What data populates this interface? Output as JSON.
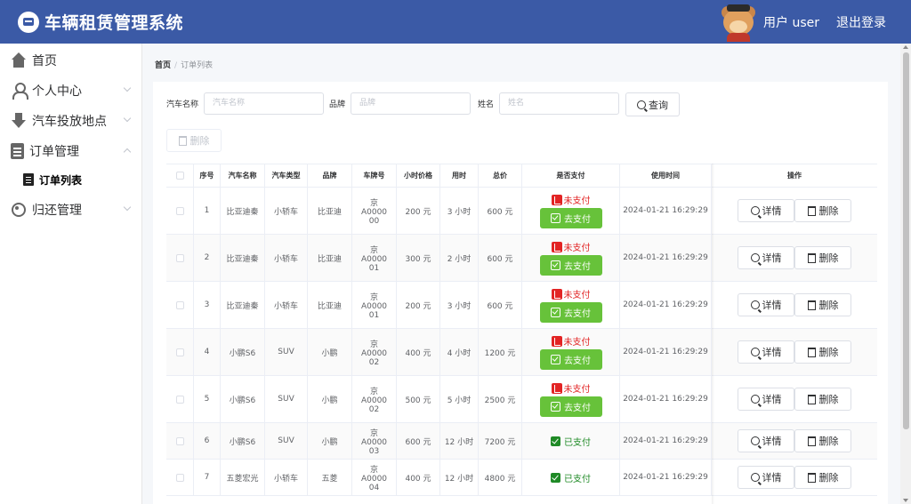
{
  "header": {
    "title": "车辆租赁管理系统",
    "user_label": "用户 user",
    "logout": "退出登录"
  },
  "sidebar": {
    "items": [
      {
        "label": "首页",
        "icon": "home-icon"
      },
      {
        "label": "个人中心",
        "icon": "user-icon"
      },
      {
        "label": "汽车投放地点",
        "icon": "download-icon"
      },
      {
        "label": "订单管理",
        "icon": "document-icon"
      },
      {
        "label": "归还管理",
        "icon": "return-icon"
      }
    ],
    "subitems": [
      {
        "label": "订单列表",
        "icon": "list-icon"
      }
    ]
  },
  "breadcrumb": {
    "home": "首页",
    "current": "订单列表"
  },
  "search": {
    "car_name_label": "汽车名称",
    "car_name_placeholder": "汽车名称",
    "brand_label": "品牌",
    "brand_placeholder": "品牌",
    "name_label": "姓名",
    "name_placeholder": "姓名",
    "query_button": "查询",
    "delete_button": "删除"
  },
  "table": {
    "headers": [
      "序号",
      "汽车名称",
      "汽车类型",
      "品牌",
      "车牌号",
      "小时价格",
      "用时",
      "总价",
      "是否支付",
      "使用时间",
      "操作"
    ],
    "rows": [
      {
        "index": "1",
        "car_name": "比亚迪秦",
        "car_type": "小轿车",
        "brand": "比亚迪",
        "plate": "京A0000 00",
        "hourly": "200 元",
        "hours": "3 小时",
        "total": "600 元",
        "paid": false,
        "time": "2024-01-21 16:29:29"
      },
      {
        "index": "2",
        "car_name": "比亚迪秦",
        "car_type": "小轿车",
        "brand": "比亚迪",
        "plate": "京A0000 01",
        "hourly": "300 元",
        "hours": "2 小时",
        "total": "600 元",
        "paid": false,
        "time": "2024-01-21 16:29:29"
      },
      {
        "index": "3",
        "car_name": "比亚迪秦",
        "car_type": "小轿车",
        "brand": "比亚迪",
        "plate": "京A0000 01",
        "hourly": "200 元",
        "hours": "3 小时",
        "total": "600 元",
        "paid": false,
        "time": "2024-01-21 16:29:29"
      },
      {
        "index": "4",
        "car_name": "小鹏S6",
        "car_type": "SUV",
        "brand": "小鹏",
        "plate": "京A0000 02",
        "hourly": "400 元",
        "hours": "4 小时",
        "total": "1200 元",
        "paid": false,
        "time": "2024-01-21 16:29:29"
      },
      {
        "index": "5",
        "car_name": "小鹏S6",
        "car_type": "SUV",
        "brand": "小鹏",
        "plate": "京A0000 02",
        "hourly": "500 元",
        "hours": "5 小时",
        "total": "2500 元",
        "paid": false,
        "time": "2024-01-21 16:29:29"
      },
      {
        "index": "6",
        "car_name": "小鹏S6",
        "car_type": "SUV",
        "brand": "小鹏",
        "plate": "京A0000 03",
        "hourly": "600 元",
        "hours": "12 小时",
        "total": "7200 元",
        "paid": true,
        "time": "2024-01-21 16:29:29"
      },
      {
        "index": "7",
        "car_name": "五菱宏光",
        "car_type": "小轿车",
        "brand": "五菱",
        "plate": "京A0000 04",
        "hourly": "400 元",
        "hours": "12 小时",
        "total": "4800 元",
        "paid": true,
        "time": "2024-01-21 16:29:29"
      }
    ],
    "unpaid_text": "未支付",
    "pay_button": "去支付",
    "paid_text": "已支付",
    "detail_button": "详情",
    "delete_button": "删除"
  },
  "colors": {
    "header_bg": "#3b5aa6",
    "pay_green": "#67c23a",
    "unpaid_red": "#e22424",
    "paid_green": "#1f8a26"
  }
}
